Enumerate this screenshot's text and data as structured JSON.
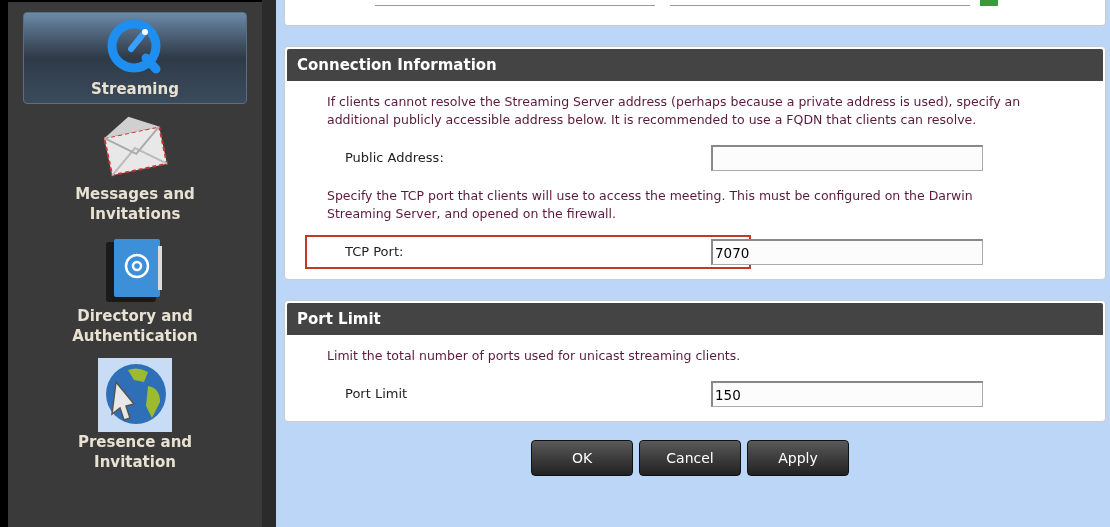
{
  "sidebar": {
    "items": [
      {
        "label": "Streaming",
        "selected": true
      },
      {
        "label": "Messages and Invitations",
        "selected": false
      },
      {
        "label": "Directory and Authentication",
        "selected": false
      },
      {
        "label": "Presence and Invitation",
        "selected": false
      }
    ]
  },
  "sections": [
    {
      "title": "Connection Information",
      "content": [
        {
          "kind": "text",
          "text": "If clients cannot resolve the Streaming Server address (perhaps because a private address is used), specify an additional publicly accessible address below. It is recommended to use a FQDN that clients can resolve."
        },
        {
          "kind": "field",
          "label": "Public Address:",
          "highlighted": false
        },
        {
          "kind": "text",
          "text": "Specify the TCP port that clients will use to access the meeting. This must be configured on the Darwin Streaming Server, and opened on the firewall."
        },
        {
          "kind": "field",
          "label": "TCP Port:",
          "value": "7070",
          "highlighted": true
        }
      ]
    },
    {
      "title": "Port Limit",
      "content": [
        {
          "kind": "text",
          "text": "Limit the total number of ports used for unicast streaming clients."
        },
        {
          "kind": "field",
          "label": "Port Limit",
          "value": "150",
          "highlighted": false
        }
      ]
    }
  ],
  "buttons": [
    "OK",
    "Cancel",
    "Apply"
  ]
}
